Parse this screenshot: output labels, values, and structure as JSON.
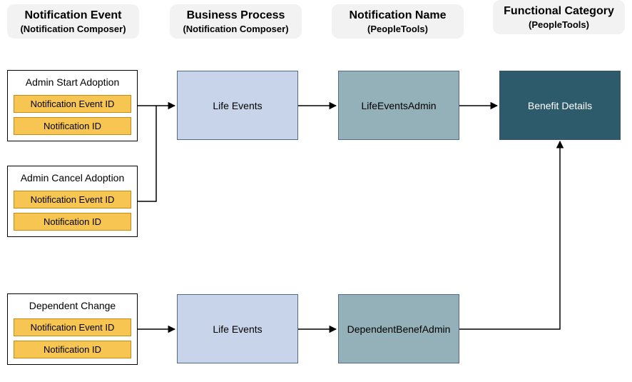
{
  "headers": {
    "event": {
      "title": "Notification Event",
      "sub": "(Notification Composer)"
    },
    "process": {
      "title": "Business Process",
      "sub": "(Notification Composer)"
    },
    "name": {
      "title": "Notification Name",
      "sub": "(PeopleTools)"
    },
    "category": {
      "title": "Functional Category",
      "sub": "(PeopleTools)"
    }
  },
  "events": {
    "adminStart": {
      "title": "Admin Start Adoption",
      "chip1": "Notification Event ID",
      "chip2": "Notification ID"
    },
    "adminCancel": {
      "title": "Admin Cancel Adoption",
      "chip1": "Notification Event ID",
      "chip2": "Notification ID"
    },
    "dependent": {
      "title": "Dependent Change",
      "chip1": "Notification Event ID",
      "chip2": "Notification ID"
    }
  },
  "processes": {
    "row1": "Life Events",
    "row2": "Life Events"
  },
  "names": {
    "row1": "LifeEventsAdmin",
    "row2": "DependentBenefAdmin"
  },
  "category": {
    "label": "Benefit Details"
  }
}
